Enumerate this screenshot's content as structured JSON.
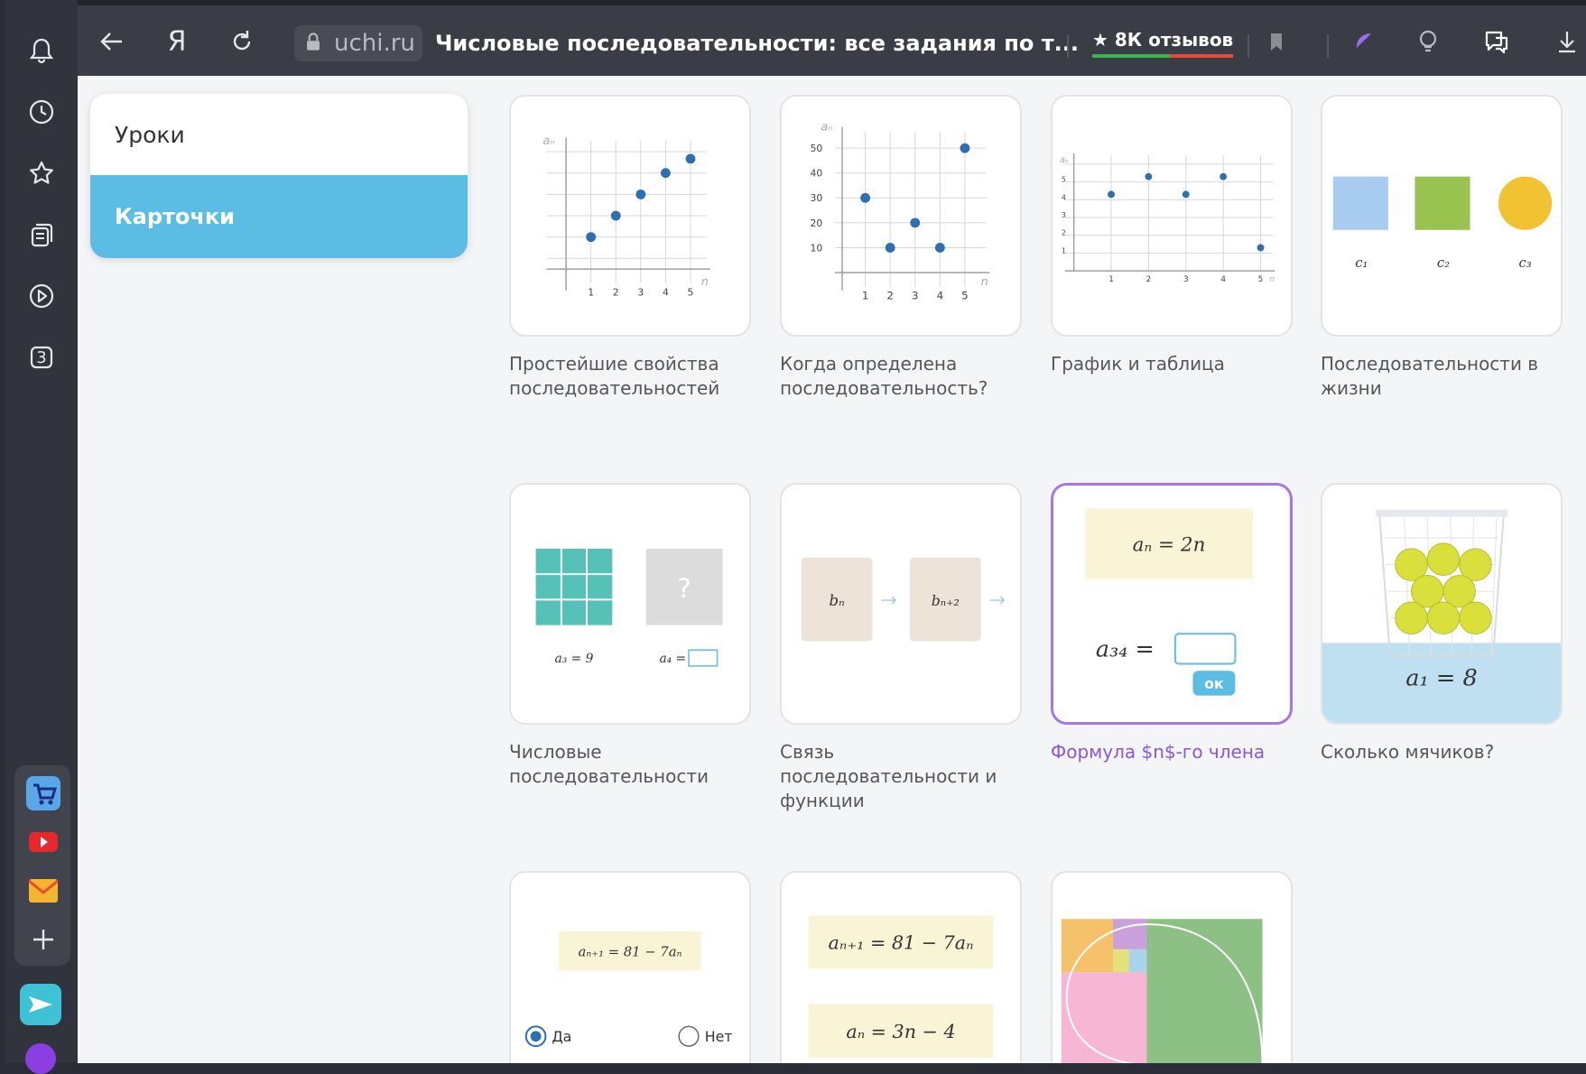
{
  "browser": {
    "domain": "uchi.ru",
    "page_title": "Числовые последовательности: все задания по т...",
    "reviews": "★ 8К отзывов",
    "browser_logo": "Я",
    "sidebar_badge": "3"
  },
  "menu": {
    "lessons": "Уроки",
    "cards": "Карточки"
  },
  "cards": [
    {
      "caption": "Простейшие свойства последовательностей",
      "y_label": "aₙ",
      "x_label": "n",
      "ticks": [
        "1",
        "2",
        "3",
        "4",
        "5"
      ]
    },
    {
      "caption": "Когда определена последовательность?",
      "y_label": "aₙ",
      "x_label": "n",
      "yticks": [
        "50",
        "40",
        "30",
        "20",
        "10"
      ],
      "ticks": [
        "1",
        "2",
        "3",
        "4",
        "5"
      ]
    },
    {
      "caption": "График и таблица",
      "y_label": "aₙ",
      "x_label": "n",
      "yticks": [
        "5",
        "4",
        "3",
        "2",
        "1"
      ],
      "ticks": [
        "1",
        "2",
        "3",
        "4",
        "5"
      ]
    },
    {
      "caption": "Последовательности в жизни",
      "labels": [
        "c₁",
        "c₂",
        "c₃"
      ]
    },
    {
      "caption": "Числовые последовательности",
      "left_label": "a₃ = 9",
      "right_label": "a₄ =",
      "question": "?"
    },
    {
      "caption": "Связь последовательности и функции",
      "b1": "bₙ",
      "b2": "bₙ₊₂"
    },
    {
      "caption": "Формула $n$-го члена",
      "formula": "aₙ = 2n",
      "question": "a₃₄ =",
      "ok": "ок"
    },
    {
      "caption": "Сколько мячиков?",
      "label": "a₁ = 8"
    },
    {
      "caption": "",
      "formula": "aₙ₊₁ = 81 − 7aₙ",
      "yes": "Да",
      "no": "Нет"
    },
    {
      "caption": "",
      "formula1": "aₙ₊₁ = 81 − 7aₙ",
      "formula2": "aₙ = 3n − 4"
    },
    {
      "caption": ""
    }
  ],
  "colors": {
    "accent": "#5bbce4",
    "active": "#a675e8",
    "dot": "#2e6fb2",
    "teal": "#56c1b7",
    "green": "#9ac24e",
    "yellow": "#f1c232",
    "light_blue": "#a7ccef"
  }
}
